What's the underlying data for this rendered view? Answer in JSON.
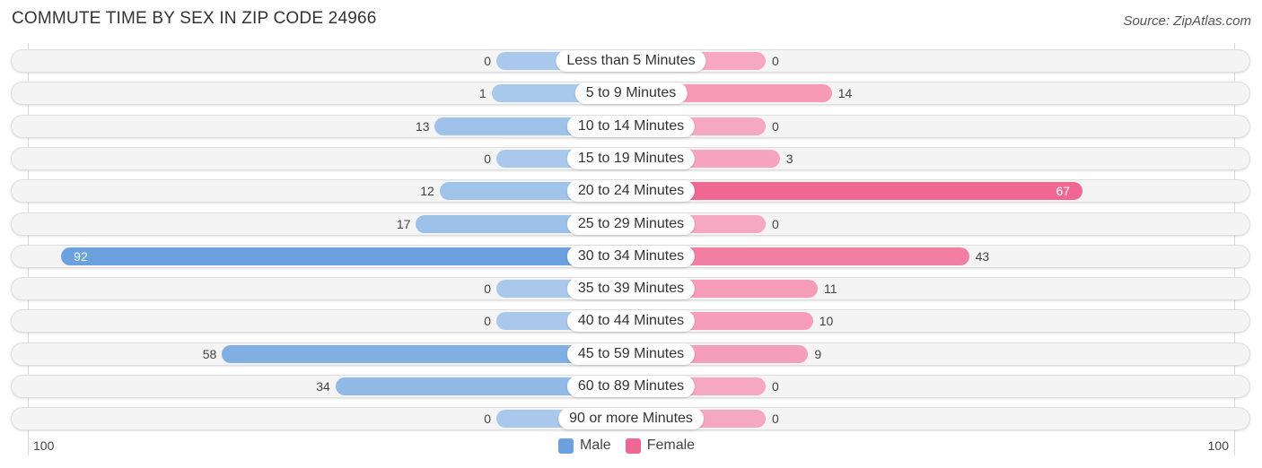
{
  "chart_data": {
    "type": "bar",
    "orientation": "horizontal-diverging",
    "title": "COMMUTE TIME BY SEX IN ZIP CODE 24966",
    "source": "Source: ZipAtlas.com",
    "categories": [
      "Less than 5 Minutes",
      "5 to 9 Minutes",
      "10 to 14 Minutes",
      "15 to 19 Minutes",
      "20 to 24 Minutes",
      "25 to 29 Minutes",
      "30 to 34 Minutes",
      "35 to 39 Minutes",
      "40 to 44 Minutes",
      "45 to 59 Minutes",
      "60 to 89 Minutes",
      "90 or more Minutes"
    ],
    "series": [
      {
        "name": "Male",
        "color": "#6aa1de",
        "light_color": "#a9c8ec",
        "values": [
          0,
          1,
          13,
          0,
          12,
          17,
          92,
          0,
          0,
          58,
          34,
          0
        ]
      },
      {
        "name": "Female",
        "color": "#f06792",
        "light_color": "#f6a7c1",
        "values": [
          0,
          14,
          0,
          3,
          67,
          0,
          43,
          11,
          10,
          9,
          0,
          0
        ]
      }
    ],
    "axis": {
      "left_label": "100",
      "right_label": "100",
      "range": [
        0,
        100
      ]
    },
    "legend": {
      "position": "bottom-center",
      "items": [
        "Male",
        "Female"
      ]
    }
  }
}
